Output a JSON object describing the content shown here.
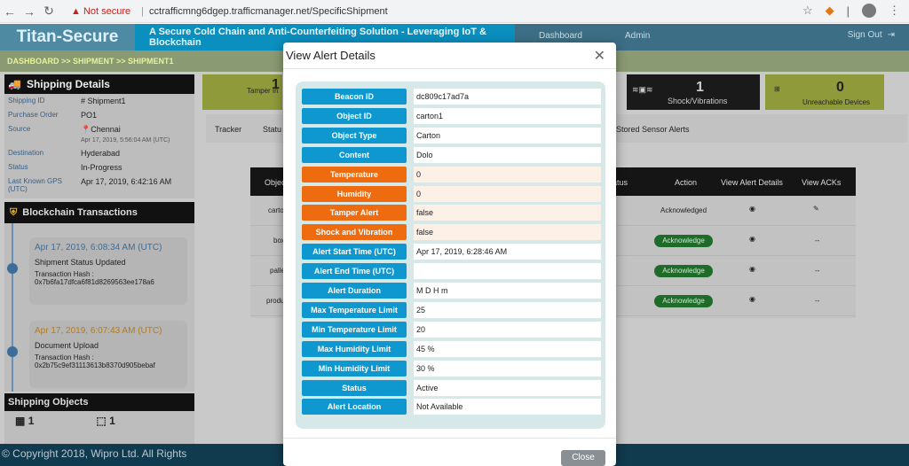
{
  "browser": {
    "security_label": "Not secure",
    "url": "cctrafficmng6dgep.trafficmanager.net/SpecificShipment"
  },
  "app": {
    "brand": "Titan-Secure",
    "tagline": "A Secure Cold Chain and Anti-Counterfeiting Solution - Leveraging IoT & Blockchain",
    "nav": [
      "Dashboard",
      "Admin"
    ],
    "sign_out": "Sign Out"
  },
  "breadcrumb": "DASHBOARD >> SHIPMENT >> SHIPMENT1",
  "shipping_details": {
    "title": "Shipping Details",
    "fields": [
      {
        "label": "Shipping ID",
        "value": "# Shipment1"
      },
      {
        "label": "Purchase Order",
        "value": "PO1"
      },
      {
        "label": "Source",
        "value": "Chennai"
      },
      {
        "label": "Destination",
        "value": "Hyderabad"
      },
      {
        "label": "Status",
        "value": "In-Progress"
      },
      {
        "label": "Last Known GPS (UTC)",
        "value": "Apr 17, 2019, 6:42:16 AM"
      }
    ],
    "source_time": "Apr 17, 2019, 5:56:04 AM (UTC)"
  },
  "blockchain": {
    "title": "Blockchain Transactions",
    "transactions": [
      {
        "time": "Apr 17, 2019, 6:08:34 AM (UTC)",
        "title": "Shipment Status Updated",
        "hash_label": "Transaction Hash :",
        "hash": "0x7b6fa17dfca6f81d8269563ee178a6"
      },
      {
        "time": "Apr 17, 2019, 6:07:43 AM (UTC)",
        "title": "Document Upload",
        "hash_label": "Transaction Hash :",
        "hash": "0x2b75c9ef31113613b8370d905bebaf"
      }
    ]
  },
  "shipping_objects": {
    "title": "Shipping Objects",
    "counts": [
      "1",
      "1"
    ]
  },
  "tiles": [
    {
      "label": "Tamper In",
      "count": "1"
    },
    {
      "label": "Shock/Vibrations",
      "count": "1"
    },
    {
      "label": "Unreachable Devices",
      "count": "0"
    }
  ],
  "tabs": [
    "Tracker",
    "Statu",
    "Stored Sensor Alerts"
  ],
  "grid": {
    "headers": [
      "Objec",
      "atus",
      "Action",
      "View Alert Details",
      "View ACKs"
    ],
    "rows": [
      {
        "obj": "carto",
        "action": "Acknowledged",
        "ack": "--"
      },
      {
        "obj": "box",
        "action": "Acknowledge",
        "ack": "--"
      },
      {
        "obj": "palle",
        "action": "Acknowledge",
        "ack": "--"
      },
      {
        "obj": "produ",
        "action": "Acknowledge",
        "ack": "--"
      }
    ]
  },
  "footer": "© Copyright 2018, Wipro Ltd. All Rights",
  "modal": {
    "title": "View Alert Details",
    "close_label": "Close",
    "fields": [
      {
        "label": "Beacon ID",
        "value": "dc809c17ad7a",
        "color": "#0f98d0"
      },
      {
        "label": "Object ID",
        "value": "carton1",
        "color": "#0f98d0"
      },
      {
        "label": "Object Type",
        "value": "Carton",
        "color": "#0f98d0"
      },
      {
        "label": "Content",
        "value": "Dolo",
        "color": "#0f98d0"
      },
      {
        "label": "Temperature",
        "value": "0",
        "color": "#ee6b10"
      },
      {
        "label": "Humidity",
        "value": "0",
        "color": "#ee6b10"
      },
      {
        "label": "Tamper Alert",
        "value": "false",
        "color": "#ee6b10"
      },
      {
        "label": "Shock and Vibration",
        "value": "false",
        "color": "#ee6b10"
      },
      {
        "label": "Alert Start Time (UTC)",
        "value": "Apr 17, 2019, 6:28:46 AM",
        "color": "#0f98d0"
      },
      {
        "label": "Alert End Time (UTC)",
        "value": "",
        "color": "#0f98d0"
      },
      {
        "label": "Alert Duration",
        "value": "M D H m",
        "color": "#0f98d0"
      },
      {
        "label": "Max Temperature Limit",
        "value": "25",
        "color": "#0f98d0"
      },
      {
        "label": "Min Temperature Limit",
        "value": "20",
        "color": "#0f98d0"
      },
      {
        "label": "Max Humidity Limit",
        "value": "45 %",
        "color": "#0f98d0"
      },
      {
        "label": "Min Humidity Limit",
        "value": "30 %",
        "color": "#0f98d0"
      },
      {
        "label": "Status",
        "value": "Active",
        "color": "#0f98d0"
      },
      {
        "label": "Alert Location",
        "value": "Not Available",
        "color": "#0f98d0"
      }
    ]
  }
}
